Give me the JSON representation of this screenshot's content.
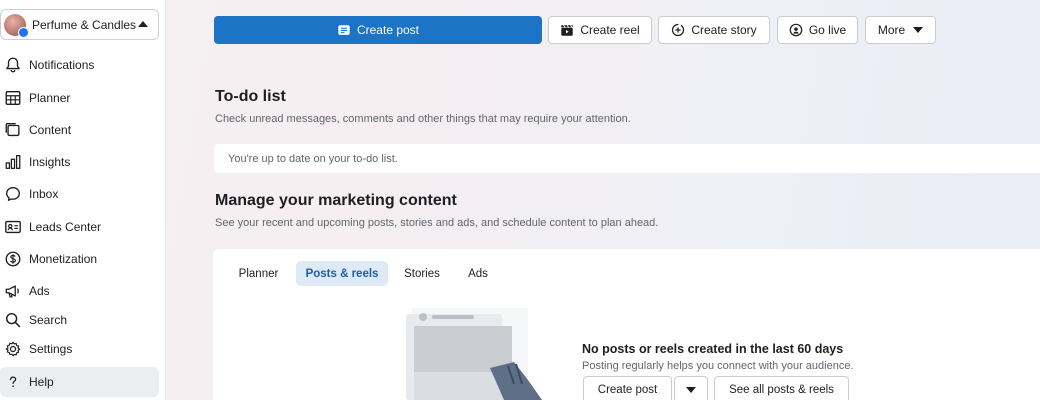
{
  "page_switcher": {
    "name": "Perfume & Candles"
  },
  "nav": [
    {
      "label": "Notifications",
      "icon": "bell-icon"
    },
    {
      "label": "Planner",
      "icon": "calendar-grid-icon"
    },
    {
      "label": "Content",
      "icon": "content-stack-icon"
    },
    {
      "label": "Insights",
      "icon": "bar-chart-icon"
    },
    {
      "label": "Inbox",
      "icon": "chat-bubble-icon"
    },
    {
      "label": "Leads Center",
      "icon": "contact-card-icon"
    },
    {
      "label": "Monetization",
      "icon": "dollar-circle-icon"
    },
    {
      "label": "Ads",
      "icon": "megaphone-icon"
    },
    {
      "label": "Search",
      "icon": "search-icon"
    },
    {
      "label": "Settings",
      "icon": "gear-icon"
    },
    {
      "label": "Help",
      "icon": "question-icon",
      "active": true
    }
  ],
  "actions": {
    "create_post": "Create post",
    "create_reel": "Create reel",
    "create_story": "Create story",
    "go_live": "Go live",
    "more": "More"
  },
  "todo": {
    "title": "To-do list",
    "subtitle": "Check unread messages, comments and other things that may require your attention.",
    "status": "You're up to date on your to-do list."
  },
  "marketing": {
    "title": "Manage your marketing content",
    "subtitle": "See your recent and upcoming posts, stories and ads, and schedule content to plan ahead.",
    "tabs": [
      "Planner",
      "Posts & reels",
      "Stories",
      "Ads"
    ],
    "active_tab": "Posts & reels",
    "empty_title": "No posts or reels created in the last 60 days",
    "empty_subtitle": "Posting regularly helps you connect with your audience.",
    "create_post": "Create post",
    "see_all": "See all posts & reels"
  },
  "colors": {
    "primary": "#1b74c5",
    "active_tab_bg": "#dfeaf7",
    "active_tab_text": "#1b5fa8"
  }
}
